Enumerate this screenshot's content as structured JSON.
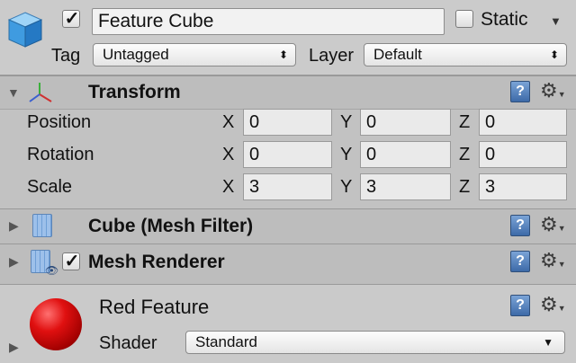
{
  "header": {
    "active_checked": true,
    "object_name": "Feature Cube",
    "static_label": "Static",
    "static_checked": false,
    "tag_label": "Tag",
    "tag_value": "Untagged",
    "layer_label": "Layer",
    "layer_value": "Default"
  },
  "transform": {
    "title": "Transform",
    "rows": [
      {
        "label": "Position",
        "x": "0",
        "y": "0",
        "z": "0"
      },
      {
        "label": "Rotation",
        "x": "0",
        "y": "0",
        "z": "0"
      },
      {
        "label": "Scale",
        "x": "3",
        "y": "3",
        "z": "3"
      }
    ],
    "axis_x": "X",
    "axis_y": "Y",
    "axis_z": "Z"
  },
  "mesh_filter": {
    "title": "Cube (Mesh Filter)"
  },
  "mesh_renderer": {
    "title": "Mesh Renderer",
    "checked": true
  },
  "material": {
    "name": "Red Feature",
    "shader_label": "Shader",
    "shader_value": "Standard"
  },
  "icons": {
    "help": "book-help-icon",
    "settings": "gear-icon"
  },
  "colors": {
    "background": "#c2c2c2",
    "help_icon": "#4a78b5",
    "material_sphere": "#d01010"
  }
}
